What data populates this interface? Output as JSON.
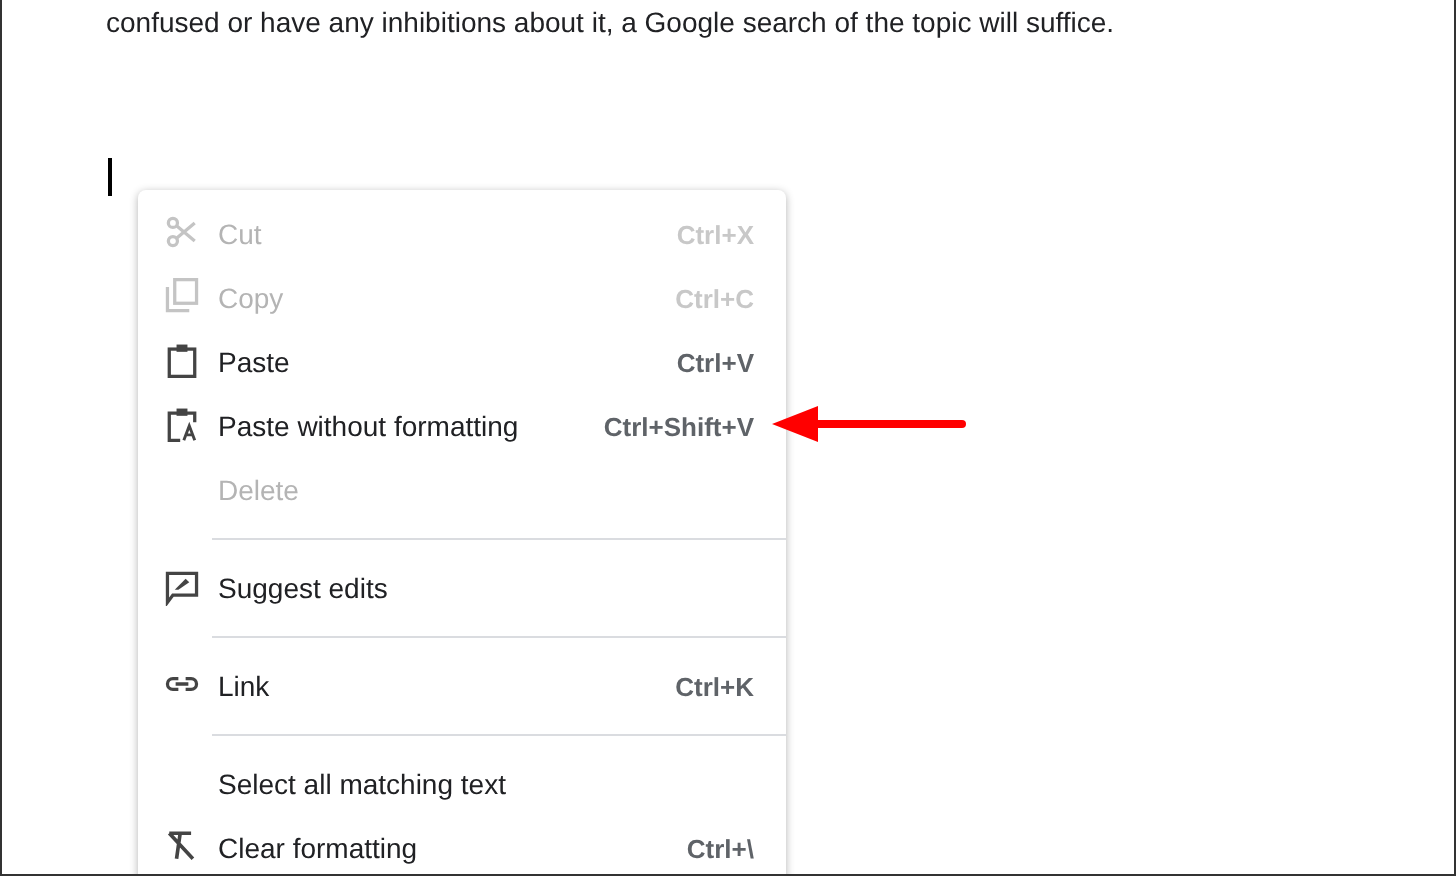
{
  "document": {
    "text": "confused or have any inhibitions about it, a Google search of the topic will suffice."
  },
  "context_menu": {
    "items": [
      {
        "kind": "item",
        "label": "Cut",
        "shortcut": "Ctrl+X",
        "disabled": true
      },
      {
        "kind": "item",
        "label": "Copy",
        "shortcut": "Ctrl+C",
        "disabled": true
      },
      {
        "kind": "item",
        "label": "Paste",
        "shortcut": "Ctrl+V",
        "disabled": false
      },
      {
        "kind": "item",
        "label": "Paste without formatting",
        "shortcut": "Ctrl+Shift+V",
        "disabled": false
      },
      {
        "kind": "item",
        "label": "Delete",
        "disabled": true
      },
      {
        "kind": "separator"
      },
      {
        "kind": "item",
        "label": "Suggest edits",
        "disabled": false
      },
      {
        "kind": "separator"
      },
      {
        "kind": "item",
        "label": "Link",
        "shortcut": "Ctrl+K",
        "disabled": false
      },
      {
        "kind": "separator"
      },
      {
        "kind": "item",
        "label": "Select all matching text",
        "disabled": false
      },
      {
        "kind": "item",
        "label": "Clear formatting",
        "shortcut": "Ctrl+\\",
        "disabled": false
      }
    ]
  }
}
